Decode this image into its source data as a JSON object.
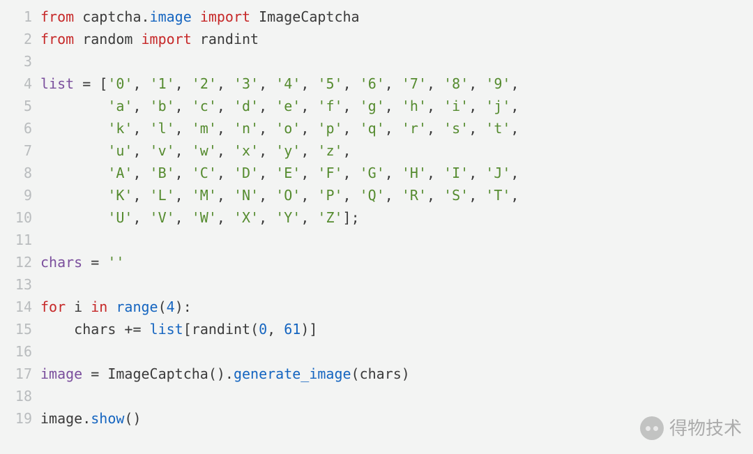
{
  "lines": [
    {
      "n": "1",
      "tokens": [
        {
          "cls": "kw",
          "t": "from"
        },
        {
          "t": " captcha."
        },
        {
          "cls": "mod",
          "t": "image"
        },
        {
          "t": " "
        },
        {
          "cls": "kw",
          "t": "import"
        },
        {
          "t": " ImageCaptcha"
        }
      ]
    },
    {
      "n": "2",
      "tokens": [
        {
          "cls": "kw",
          "t": "from"
        },
        {
          "t": " random "
        },
        {
          "cls": "kw",
          "t": "import"
        },
        {
          "t": " randint"
        }
      ]
    },
    {
      "n": "3",
      "tokens": []
    },
    {
      "n": "4",
      "tokens": [
        {
          "cls": "name",
          "t": "list"
        },
        {
          "t": " "
        },
        {
          "cls": "op",
          "t": "="
        },
        {
          "t": " "
        },
        {
          "t": "["
        },
        {
          "cls": "str",
          "t": "'0'"
        },
        {
          "t": ", "
        },
        {
          "cls": "str",
          "t": "'1'"
        },
        {
          "t": ", "
        },
        {
          "cls": "str",
          "t": "'2'"
        },
        {
          "t": ", "
        },
        {
          "cls": "str",
          "t": "'3'"
        },
        {
          "t": ", "
        },
        {
          "cls": "str",
          "t": "'4'"
        },
        {
          "t": ", "
        },
        {
          "cls": "str",
          "t": "'5'"
        },
        {
          "t": ", "
        },
        {
          "cls": "str",
          "t": "'6'"
        },
        {
          "t": ", "
        },
        {
          "cls": "str",
          "t": "'7'"
        },
        {
          "t": ", "
        },
        {
          "cls": "str",
          "t": "'8'"
        },
        {
          "t": ", "
        },
        {
          "cls": "str",
          "t": "'9'"
        },
        {
          "t": ","
        }
      ]
    },
    {
      "n": "5",
      "tokens": [
        {
          "t": "        "
        },
        {
          "cls": "str",
          "t": "'a'"
        },
        {
          "t": ", "
        },
        {
          "cls": "str",
          "t": "'b'"
        },
        {
          "t": ", "
        },
        {
          "cls": "str",
          "t": "'c'"
        },
        {
          "t": ", "
        },
        {
          "cls": "str",
          "t": "'d'"
        },
        {
          "t": ", "
        },
        {
          "cls": "str",
          "t": "'e'"
        },
        {
          "t": ", "
        },
        {
          "cls": "str",
          "t": "'f'"
        },
        {
          "t": ", "
        },
        {
          "cls": "str",
          "t": "'g'"
        },
        {
          "t": ", "
        },
        {
          "cls": "str",
          "t": "'h'"
        },
        {
          "t": ", "
        },
        {
          "cls": "str",
          "t": "'i'"
        },
        {
          "t": ", "
        },
        {
          "cls": "str",
          "t": "'j'"
        },
        {
          "t": ","
        }
      ]
    },
    {
      "n": "6",
      "tokens": [
        {
          "t": "        "
        },
        {
          "cls": "str",
          "t": "'k'"
        },
        {
          "t": ", "
        },
        {
          "cls": "str",
          "t": "'l'"
        },
        {
          "t": ", "
        },
        {
          "cls": "str",
          "t": "'m'"
        },
        {
          "t": ", "
        },
        {
          "cls": "str",
          "t": "'n'"
        },
        {
          "t": ", "
        },
        {
          "cls": "str",
          "t": "'o'"
        },
        {
          "t": ", "
        },
        {
          "cls": "str",
          "t": "'p'"
        },
        {
          "t": ", "
        },
        {
          "cls": "str",
          "t": "'q'"
        },
        {
          "t": ", "
        },
        {
          "cls": "str",
          "t": "'r'"
        },
        {
          "t": ", "
        },
        {
          "cls": "str",
          "t": "'s'"
        },
        {
          "t": ", "
        },
        {
          "cls": "str",
          "t": "'t'"
        },
        {
          "t": ","
        }
      ]
    },
    {
      "n": "7",
      "tokens": [
        {
          "t": "        "
        },
        {
          "cls": "str",
          "t": "'u'"
        },
        {
          "t": ", "
        },
        {
          "cls": "str",
          "t": "'v'"
        },
        {
          "t": ", "
        },
        {
          "cls": "str",
          "t": "'w'"
        },
        {
          "t": ", "
        },
        {
          "cls": "str",
          "t": "'x'"
        },
        {
          "t": ", "
        },
        {
          "cls": "str",
          "t": "'y'"
        },
        {
          "t": ", "
        },
        {
          "cls": "str",
          "t": "'z'"
        },
        {
          "t": ","
        }
      ]
    },
    {
      "n": "8",
      "tokens": [
        {
          "t": "        "
        },
        {
          "cls": "str",
          "t": "'A'"
        },
        {
          "t": ", "
        },
        {
          "cls": "str",
          "t": "'B'"
        },
        {
          "t": ", "
        },
        {
          "cls": "str",
          "t": "'C'"
        },
        {
          "t": ", "
        },
        {
          "cls": "str",
          "t": "'D'"
        },
        {
          "t": ", "
        },
        {
          "cls": "str",
          "t": "'E'"
        },
        {
          "t": ", "
        },
        {
          "cls": "str",
          "t": "'F'"
        },
        {
          "t": ", "
        },
        {
          "cls": "str",
          "t": "'G'"
        },
        {
          "t": ", "
        },
        {
          "cls": "str",
          "t": "'H'"
        },
        {
          "t": ", "
        },
        {
          "cls": "str",
          "t": "'I'"
        },
        {
          "t": ", "
        },
        {
          "cls": "str",
          "t": "'J'"
        },
        {
          "t": ","
        }
      ]
    },
    {
      "n": "9",
      "tokens": [
        {
          "t": "        "
        },
        {
          "cls": "str",
          "t": "'K'"
        },
        {
          "t": ", "
        },
        {
          "cls": "str",
          "t": "'L'"
        },
        {
          "t": ", "
        },
        {
          "cls": "str",
          "t": "'M'"
        },
        {
          "t": ", "
        },
        {
          "cls": "str",
          "t": "'N'"
        },
        {
          "t": ", "
        },
        {
          "cls": "str",
          "t": "'O'"
        },
        {
          "t": ", "
        },
        {
          "cls": "str",
          "t": "'P'"
        },
        {
          "t": ", "
        },
        {
          "cls": "str",
          "t": "'Q'"
        },
        {
          "t": ", "
        },
        {
          "cls": "str",
          "t": "'R'"
        },
        {
          "t": ", "
        },
        {
          "cls": "str",
          "t": "'S'"
        },
        {
          "t": ", "
        },
        {
          "cls": "str",
          "t": "'T'"
        },
        {
          "t": ","
        }
      ]
    },
    {
      "n": "10",
      "tokens": [
        {
          "t": "        "
        },
        {
          "cls": "str",
          "t": "'U'"
        },
        {
          "t": ", "
        },
        {
          "cls": "str",
          "t": "'V'"
        },
        {
          "t": ", "
        },
        {
          "cls": "str",
          "t": "'W'"
        },
        {
          "t": ", "
        },
        {
          "cls": "str",
          "t": "'X'"
        },
        {
          "t": ", "
        },
        {
          "cls": "str",
          "t": "'Y'"
        },
        {
          "t": ", "
        },
        {
          "cls": "str",
          "t": "'Z'"
        },
        {
          "t": "];"
        }
      ]
    },
    {
      "n": "11",
      "tokens": []
    },
    {
      "n": "12",
      "tokens": [
        {
          "cls": "name",
          "t": "chars"
        },
        {
          "t": " "
        },
        {
          "cls": "op",
          "t": "="
        },
        {
          "t": " "
        },
        {
          "cls": "str",
          "t": "''"
        }
      ]
    },
    {
      "n": "13",
      "tokens": []
    },
    {
      "n": "14",
      "tokens": [
        {
          "cls": "kw",
          "t": "for"
        },
        {
          "t": " i "
        },
        {
          "cls": "kw",
          "t": "in"
        },
        {
          "t": " "
        },
        {
          "cls": "func",
          "t": "range"
        },
        {
          "t": "("
        },
        {
          "cls": "num",
          "t": "4"
        },
        {
          "t": "):"
        }
      ]
    },
    {
      "n": "15",
      "tokens": [
        {
          "t": "    chars "
        },
        {
          "cls": "op",
          "t": "+="
        },
        {
          "t": " "
        },
        {
          "cls": "func",
          "t": "list"
        },
        {
          "t": "[randint("
        },
        {
          "cls": "num",
          "t": "0"
        },
        {
          "t": ", "
        },
        {
          "cls": "num",
          "t": "61"
        },
        {
          "t": ")]"
        }
      ]
    },
    {
      "n": "16",
      "tokens": []
    },
    {
      "n": "17",
      "tokens": [
        {
          "cls": "name",
          "t": "image"
        },
        {
          "t": " "
        },
        {
          "cls": "op",
          "t": "="
        },
        {
          "t": " ImageCaptcha()."
        },
        {
          "cls": "func",
          "t": "generate_image"
        },
        {
          "t": "(chars)"
        }
      ]
    },
    {
      "n": "18",
      "tokens": []
    },
    {
      "n": "19",
      "tokens": [
        {
          "t": "image."
        },
        {
          "cls": "func",
          "t": "show"
        },
        {
          "t": "()"
        }
      ]
    }
  ],
  "watermark": "得物技术"
}
